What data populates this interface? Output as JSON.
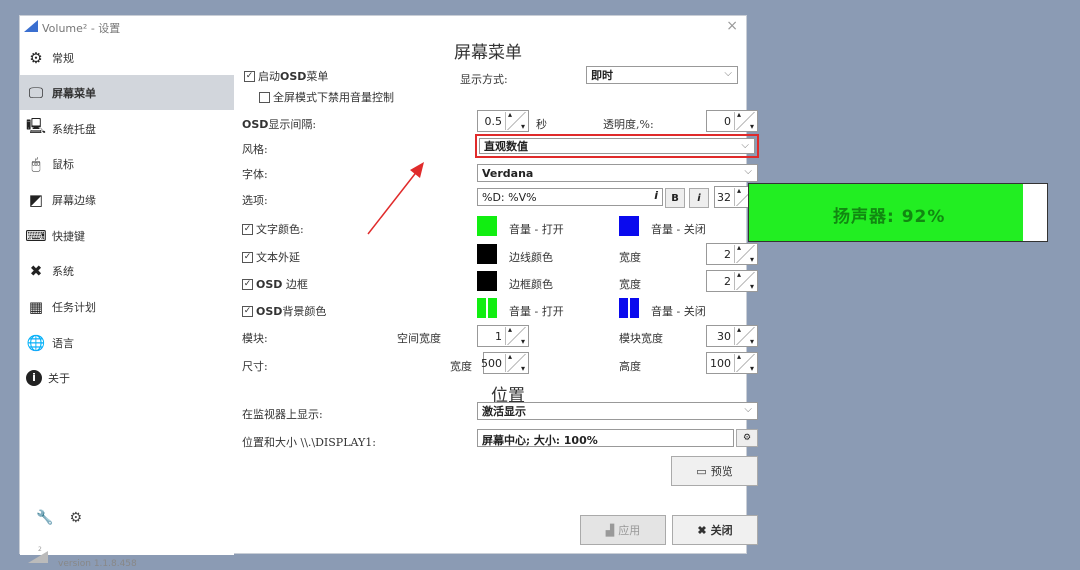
{
  "window": {
    "title": "Volume² - 设置",
    "close_glyph": "×"
  },
  "sidebar": {
    "items": [
      {
        "label": "常规",
        "icon": "gear-icon"
      },
      {
        "label": "屏幕菜单",
        "icon": "monitor-icon"
      },
      {
        "label": "系统托盘",
        "icon": "tray-icon"
      },
      {
        "label": "鼠标",
        "icon": "mouse-icon"
      },
      {
        "label": "屏幕边缘",
        "icon": "screen-edge-icon"
      },
      {
        "label": "快捷键",
        "icon": "keyboard-icon"
      },
      {
        "label": "系统",
        "icon": "tools-icon"
      },
      {
        "label": "任务计划",
        "icon": "calendar-icon"
      },
      {
        "label": "语言",
        "icon": "globe-icon"
      },
      {
        "label": "关于",
        "icon": "info-icon"
      }
    ],
    "active_index": 1,
    "version": "version 1.1.8.458"
  },
  "osd": {
    "section_title": "屏幕菜单",
    "enable_osd_label": "启动",
    "enable_osd_bold": "OSD",
    "enable_osd_suffix": "菜单",
    "fullscreen_label": "全屏模式下禁用音量控制",
    "display_mode_label": "显示方式:",
    "display_mode_value": "即时",
    "interval_label_bold": "OSD",
    "interval_label": "显示间隔:",
    "interval_value": "0.5",
    "interval_unit": "秒",
    "opacity_label": "透明度,%:",
    "opacity_value": "0",
    "style_label": "风格:",
    "style_value": "直观数值",
    "font_label": "字体:",
    "font_value": "Verdana",
    "options_label": "选项:",
    "format_value": "%D: %V%",
    "format_hint": "i",
    "bold_btn": "B",
    "italic_btn": "i",
    "font_size": "32",
    "text_color_label": "文字颜色:",
    "vol_on_label": "音量 - 打开",
    "vol_off_label": "音量 - 关闭",
    "text_outline_label": "文本外延",
    "edge_color_label": "边线颜色",
    "width_label": "宽度",
    "outline_width": "2",
    "osd_border_bold": "OSD",
    "osd_border_label": "边框",
    "border_color_label": "边框颜色",
    "border_width": "2",
    "osd_bg_bold": "OSD",
    "osd_bg_label": "背景颜色",
    "block_label": "模块:",
    "spacing_label": "空间宽度",
    "spacing_value": "1",
    "block_width_label": "模块宽度",
    "block_width_value": "30",
    "size_label": "尺寸:",
    "size_width_label": "宽度",
    "size_width_value": "500",
    "size_height_label": "高度",
    "size_height_value": "100",
    "colors": {
      "green": "#11ee11",
      "blue": "#0a0aee",
      "black": "#000000"
    }
  },
  "position": {
    "section_title": "位置",
    "monitor_label": "在监视器上显示:",
    "monitor_value": "激活显示",
    "pos_size_label": "位置和大小 \\\\.\\DISPLAY1:",
    "pos_size_value_prefix": "屏幕中心; 大小: ",
    "pos_size_value_bold": "100%",
    "preview_btn": "预览"
  },
  "footer": {
    "apply_btn": "应用",
    "close_btn": "关闭"
  },
  "preview_osd": {
    "text": "扬声器: 92%",
    "level": 0.92,
    "fill_color": "#22ee22"
  }
}
